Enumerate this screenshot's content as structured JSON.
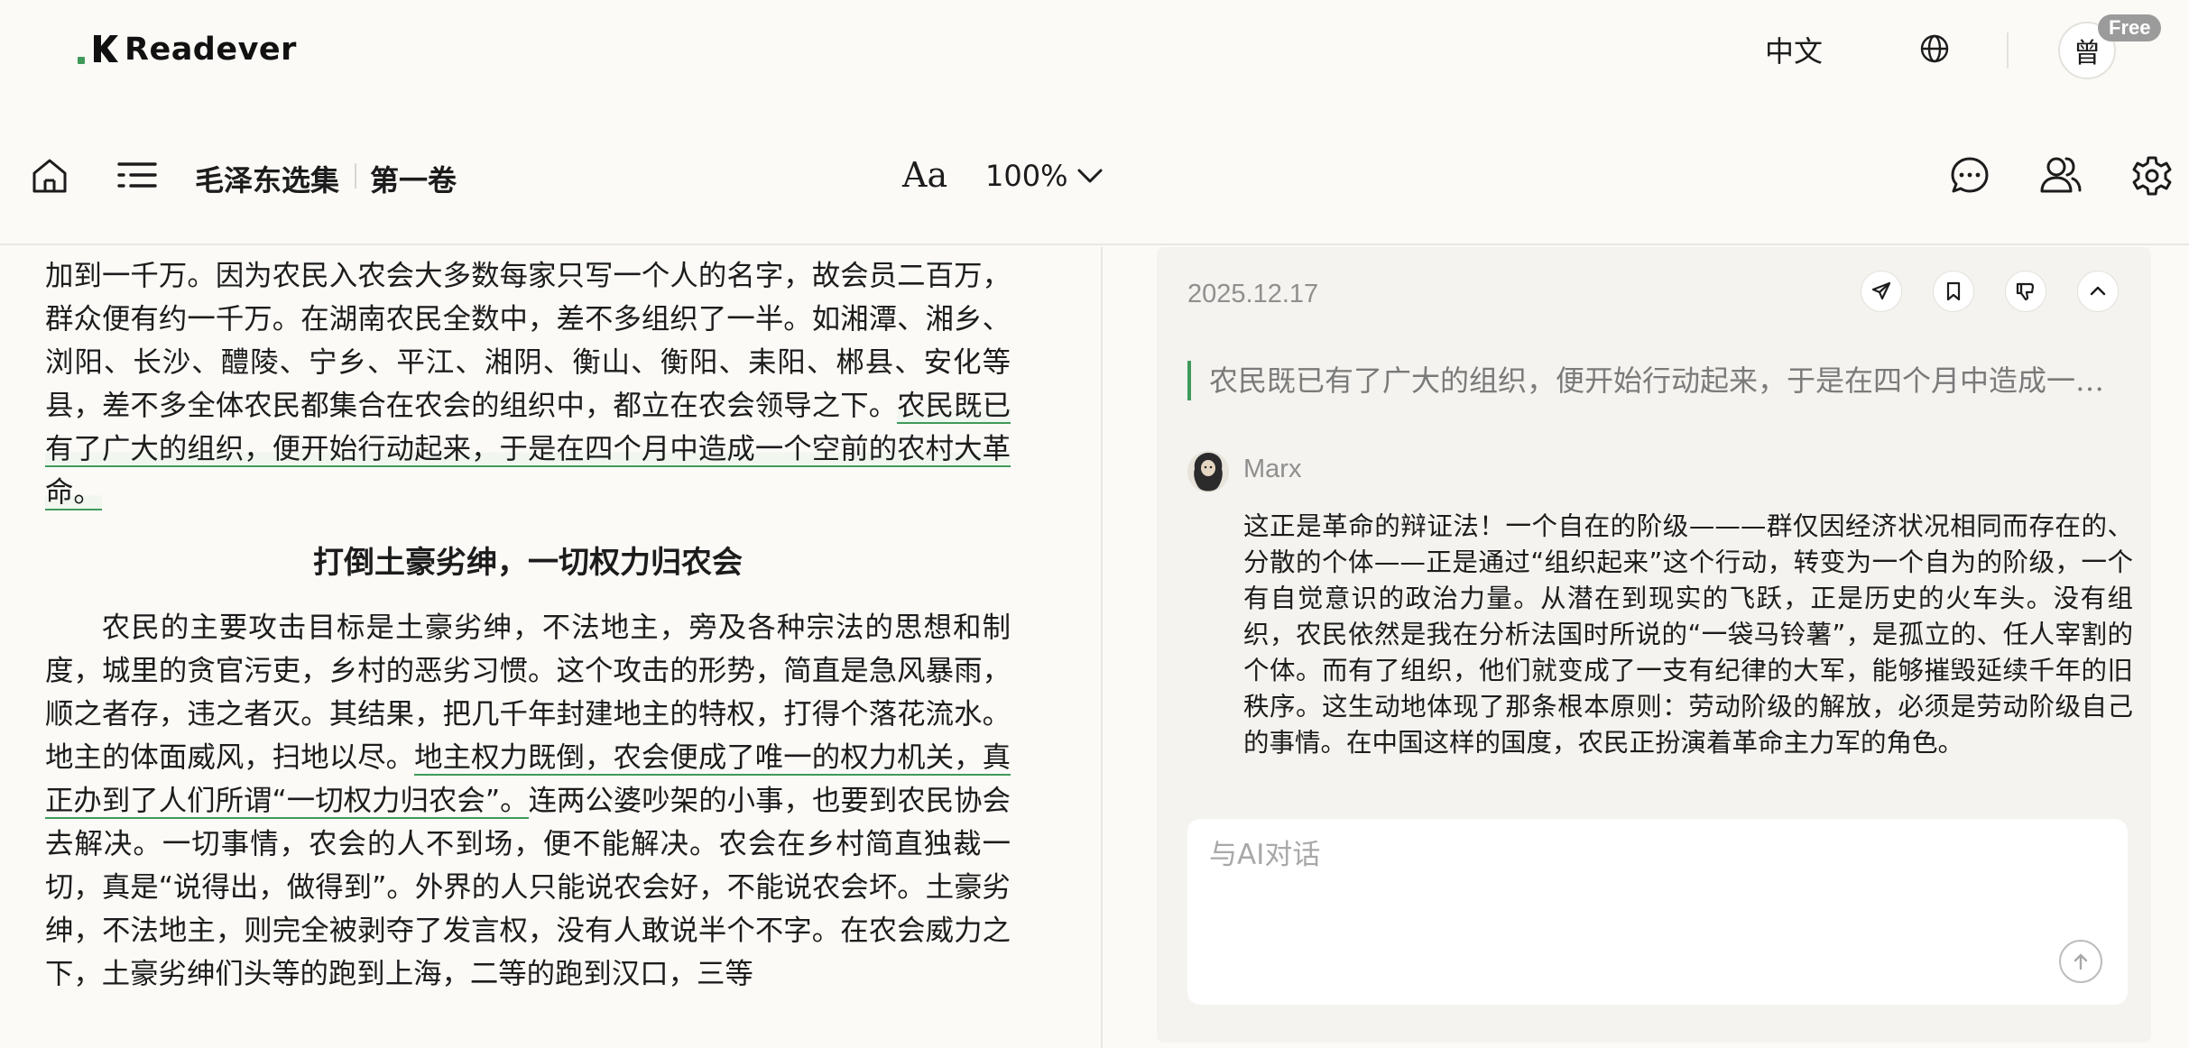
{
  "app": {
    "logo_text": "Readever"
  },
  "header": {
    "language_label": "中文",
    "user_initial": "曾",
    "plan_badge": "Free"
  },
  "toolbar": {
    "book_title": "毛泽东选集",
    "volume": "第一卷",
    "font_button": "Aa",
    "zoom_level": "100%"
  },
  "reader": {
    "para1_a": "一月为第二时期，即革命时期。农会会员激增到二百万，能直接领导的群众增加到一千万。因为农民入农会大多数每家只写一个人的名字，故会员二百万，群众便有约一千万。在湖南农民全数中，差不多组织了一半。如湘潭、湘乡、浏阳、长沙、醴陵、宁乡、平江、湘阴、衡山、衡阳、耒阳、郴县、安化等县，差不多全体农民都集合在农会的组织中，都立在农会领导之下。",
    "para1_highlight": "农民既已有了广大的组织，便开始行动起来，于是在四个月中造成一个空前的农村大革命。",
    "section_title": "打倒土豪劣绅，一切权力归农会",
    "para2_a": "农民的主要攻击目标是土豪劣绅，不法地主，旁及各种宗法的思想和制度，城里的贪官污吏，乡村的恶劣习惯。这个攻击的形势，简直是急风暴雨，顺之者存，违之者灭。其结果，把几千年封建地主的特权，打得个落花流水。地主的体面威风，扫地以尽。",
    "para2_underline": "地主权力既倒，农会便成了唯一的权力机关，真正办到了人们所谓“一切权力归农会”。",
    "para2_b": "连两公婆吵架的小事，也要到农民协会去解决。一切事情，农会的人不到场，便不能解决。农会在乡村简直独裁一切，真是“说得出，做得到”。外界的人只能说农会好，不能说农会坏。土豪劣绅，不法地主，则完全被剥夺了发言权，没有人敢说半个不字。在农会威力之下，土豪劣绅们头等的跑到上海，二等的跑到汉口，三等"
  },
  "panel": {
    "note_date": "2025.12.17",
    "quote": "农民既已有了广大的组织，便开始行动起来，于是在四个月中造成一个空前的农村大革命。",
    "ai_name": "Marx",
    "ai_reply": "这正是革命的辩证法！一个自在的阶级———群仅因经济状况相同而存在的、分散的个体——正是通过“组织起来”这个行动，转变为一个自为的阶级，一个有自觉意识的政治力量。从潜在到现实的飞跃，正是历史的火车头。没有组织，农民依然是我在分析法国时所说的“一袋马铃薯”，是孤立的、任人宰割的个体。而有了组织，他们就变成了一支有纪律的大军，能够摧毁延续千年的旧秩序。这生动地体现了那条根本原则：劳动阶级的解放，必须是劳动阶级自己的事情。在中国这样的国度，农民正扮演着革命主力军的角色。",
    "chat_placeholder": "与AI对话"
  },
  "icons": {
    "home": "home-icon",
    "toc": "menu-icon",
    "chevron": "chevron-down-icon",
    "chat": "chat-bubble-icon",
    "persona": "users-icon",
    "settings": "gear-icon",
    "globe": "globe-icon",
    "share": "send-icon",
    "bookmark": "bookmark-icon",
    "dislike": "thumbs-down-icon",
    "collapse": "chevron-up-icon",
    "send": "arrow-up-icon"
  },
  "colors": {
    "accent": "#3f9a5a",
    "background": "#fbfaf7",
    "panel": "#f4f3ef",
    "muted": "#8f8f8f"
  }
}
